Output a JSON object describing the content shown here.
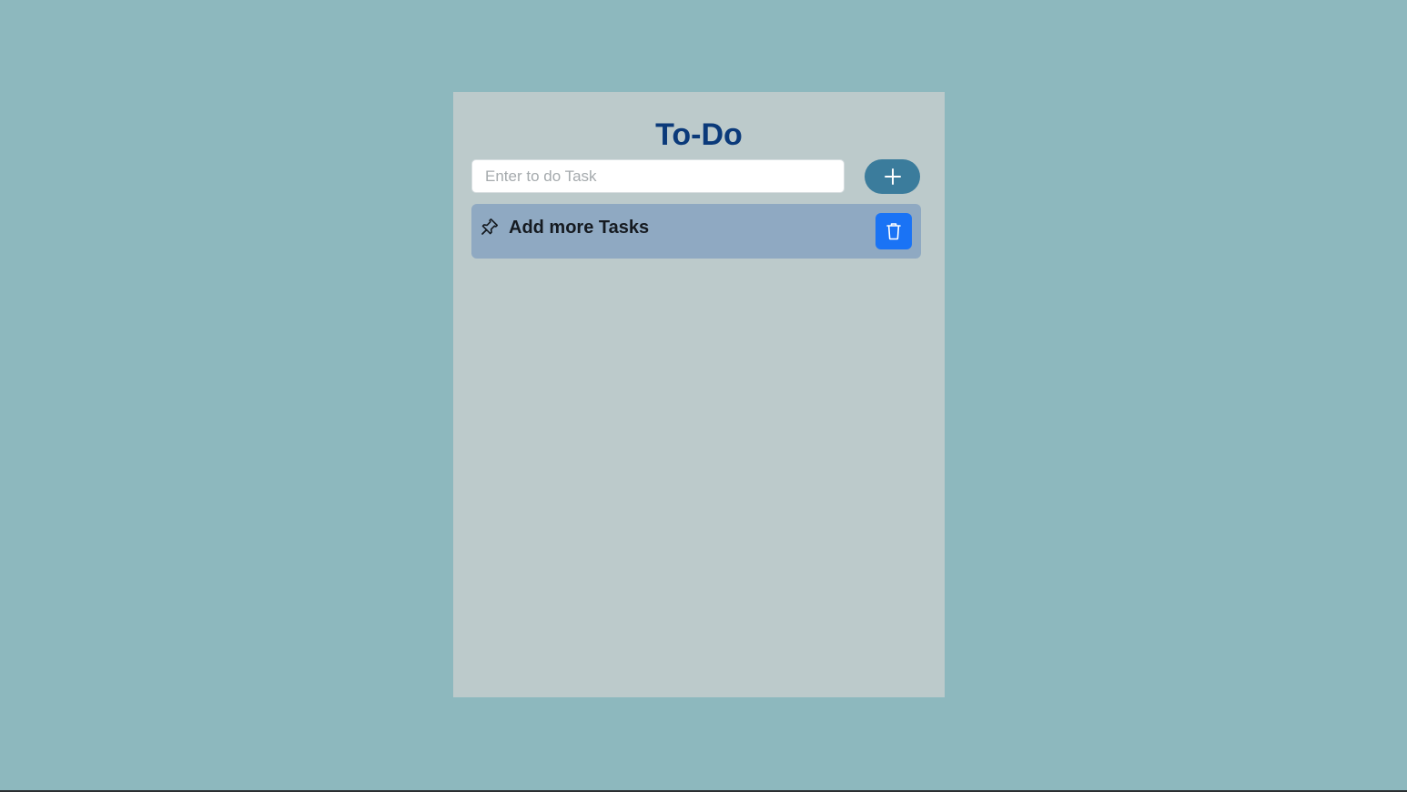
{
  "app": {
    "title": "To-Do"
  },
  "input": {
    "placeholder": "Enter to do Task",
    "value": ""
  },
  "add_button": {
    "icon": "plus-icon"
  },
  "tasks": [
    {
      "label": "Add more Tasks",
      "icon": "pin-icon",
      "delete_icon": "trash-icon"
    }
  ],
  "colors": {
    "page_background": "#8db8be",
    "card_background": "#bccacb",
    "title": "#0b3a7a",
    "add_button": "#3b7c9c",
    "task_background": "#8fa9c2",
    "delete_button": "#1a73f5"
  }
}
